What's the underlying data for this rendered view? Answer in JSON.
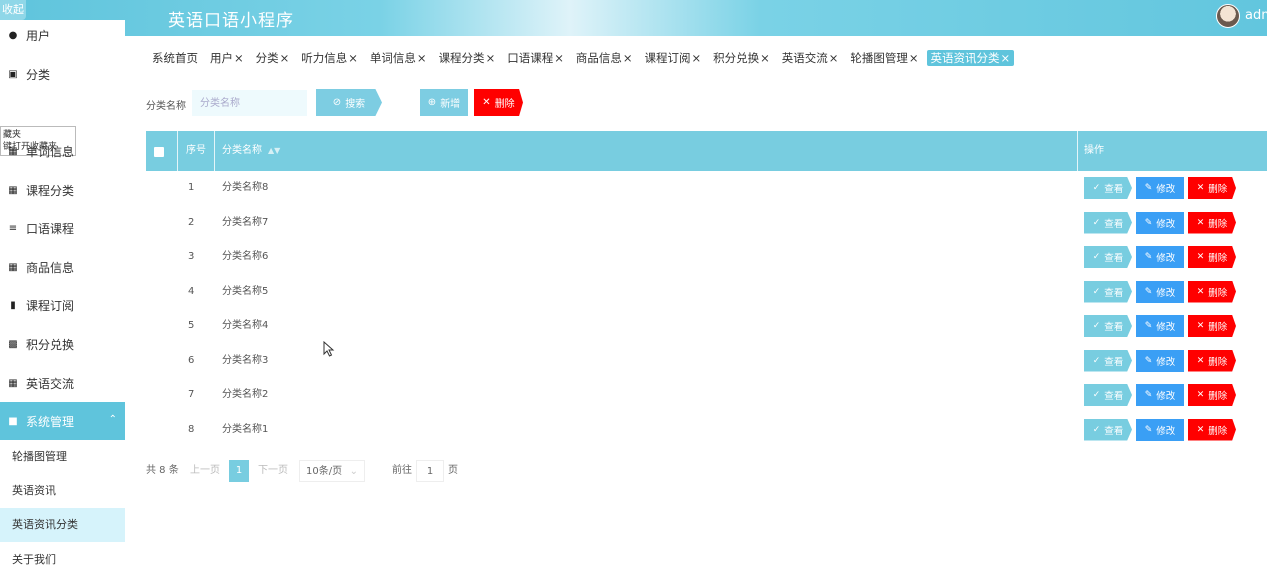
{
  "header": {
    "collapse_label": "收起",
    "app_title": "英语口语小程序",
    "user_name": "adm"
  },
  "sidebar": {
    "items": [
      {
        "label": "用户",
        "icon": "pin-icon"
      },
      {
        "label": "分类",
        "icon": "clipboard-icon"
      },
      {
        "label": "单词信息",
        "icon": "grid-icon"
      },
      {
        "label": "课程分类",
        "icon": "grid-icon"
      },
      {
        "label": "口语课程",
        "icon": "list-icon"
      },
      {
        "label": "商品信息",
        "icon": "grid-icon"
      },
      {
        "label": "课程订阅",
        "icon": "document-icon"
      },
      {
        "label": "积分兑换",
        "icon": "message-icon"
      },
      {
        "label": "英语交流",
        "icon": "grid-icon"
      }
    ],
    "system_group": {
      "label": "系统管理",
      "icon": "square-icon"
    },
    "sub_items": [
      {
        "label": "轮播图管理"
      },
      {
        "label": "英语资讯"
      },
      {
        "label": "英语资讯分类"
      },
      {
        "label": "关于我们"
      }
    ],
    "fav_tip_line1": "藏夹",
    "fav_tip_line2": "键打开收藏夹"
  },
  "tabs": [
    {
      "label": "系统首页",
      "closable": false
    },
    {
      "label": "用户",
      "closable": true
    },
    {
      "label": "分类",
      "closable": true
    },
    {
      "label": "听力信息",
      "closable": true
    },
    {
      "label": "单词信息",
      "closable": true
    },
    {
      "label": "课程分类",
      "closable": true
    },
    {
      "label": "口语课程",
      "closable": true
    },
    {
      "label": "商品信息",
      "closable": true
    },
    {
      "label": "课程订阅",
      "closable": true
    },
    {
      "label": "积分兑换",
      "closable": true
    },
    {
      "label": "英语交流",
      "closable": true
    },
    {
      "label": "轮播图管理",
      "closable": true
    },
    {
      "label": "英语资讯分类",
      "closable": true,
      "active": true
    }
  ],
  "search": {
    "label": "分类名称",
    "placeholder": "分类名称",
    "search_btn": "搜索",
    "add_btn": "新增",
    "delete_btn": "删除"
  },
  "table": {
    "col_index": "序号",
    "col_name": "分类名称",
    "col_ops": "操作",
    "view_label": "查看",
    "edit_label": "修改",
    "delete_label": "删除",
    "rows": [
      {
        "index": "1",
        "name": "分类名称8"
      },
      {
        "index": "2",
        "name": "分类名称7"
      },
      {
        "index": "3",
        "name": "分类名称6"
      },
      {
        "index": "4",
        "name": "分类名称5"
      },
      {
        "index": "5",
        "name": "分类名称4"
      },
      {
        "index": "6",
        "name": "分类名称3"
      },
      {
        "index": "7",
        "name": "分类名称2"
      },
      {
        "index": "8",
        "name": "分类名称1"
      }
    ]
  },
  "pager": {
    "total": "共 8 条",
    "prev": "上一页",
    "current": "1",
    "next": "下一页",
    "page_size": "10条/页",
    "goto": "前往",
    "goto_value": "1",
    "page_unit": "页"
  },
  "colors": {
    "accent": "#5fc4dc",
    "edit_blue": "#3a9ff5",
    "danger": "#ff0000"
  }
}
